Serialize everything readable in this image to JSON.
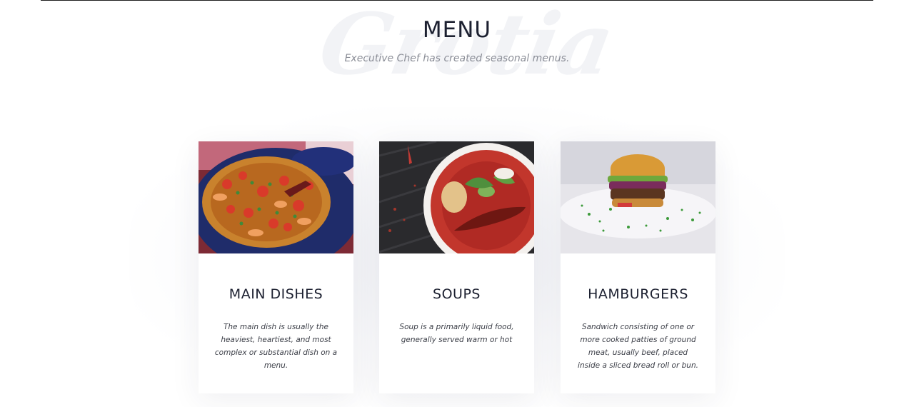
{
  "watermark": "Grotia",
  "section": {
    "title": "MENU",
    "subtitle": "Executive Chef has created seasonal menus."
  },
  "cards": [
    {
      "image_icon": "paella-dish-image",
      "title": "MAIN DISHES",
      "description": "The main dish is usually the heaviest, heartiest, and most complex or substantial dish on a menu."
    },
    {
      "image_icon": "soup-bowl-image",
      "title": "SOUPS",
      "description": "Soup is a primarily liquid food, generally served warm or hot"
    },
    {
      "image_icon": "hamburger-image",
      "title": "HAMBURGERS",
      "description": "Sandwich consisting of one or more cooked patties of ground meat, usually beef, placed inside a sliced bread roll or bun."
    }
  ],
  "colors": {
    "heading": "#1c2030",
    "subtitle": "#8b8e97",
    "watermark": "#f2f3f6",
    "rule": "#1f1f1f"
  }
}
